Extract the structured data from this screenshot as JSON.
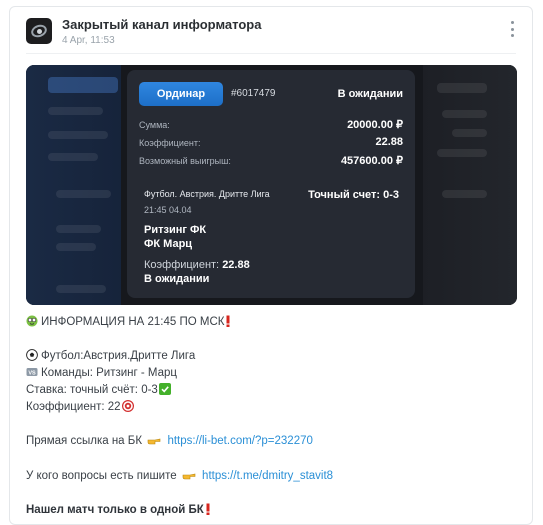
{
  "channel": {
    "name": "Закрытый канал информатора",
    "date": "4 Apr, 11:53"
  },
  "bet_card": {
    "type_button": "Ординар",
    "bet_id": "#6017479",
    "status": "В ожидании",
    "rows": [
      {
        "label": "Сумма:",
        "value": "20000.00 ₽"
      },
      {
        "label": "Коэффициент:",
        "value": "22.88"
      },
      {
        "label": "Возможный выигрыш:",
        "value": "457600.00 ₽"
      }
    ],
    "event_title": "Футбол. Австрия. Дритте Лига",
    "event_time": "21:45 04.04",
    "market": "Точный счет: 0-3",
    "team_home": "Ритзинг ФК",
    "team_away": "ФК Марц",
    "coef_label": "Коэффициент:",
    "coef_value": "22.88",
    "bottom_status": "В ожидании"
  },
  "message": {
    "info_line": "ИНФОРМАЦИЯ НА 21:45 ПО МСК",
    "sport_line": "Футбол:Австрия.Дритте Лига",
    "teams_line": "Команды: Ритзинг - Марц",
    "bet_line": "Ставка: точный счёт: 0-3",
    "coef_line": "Коэффициент: 22",
    "link_label": "Прямая ссылка на БК",
    "link_url": "https://li-bet.com/?p=232270",
    "questions_label": "У кого вопросы есть пишите",
    "questions_url": "https://t.me/dmitry_stavit8",
    "footer": "Нашел матч только в одной БК"
  },
  "icons": {
    "avatar": "channel-avatar-icon",
    "menu": "more-vertical-icon",
    "nerd": "nerd-face-emoji-icon",
    "exclamation": "red-exclamation-icon",
    "soccer": "soccer-ball-icon",
    "vs": "vs-badge-icon",
    "check": "green-check-icon",
    "target": "target-icon",
    "pointing": "pointing-hand-icon"
  }
}
